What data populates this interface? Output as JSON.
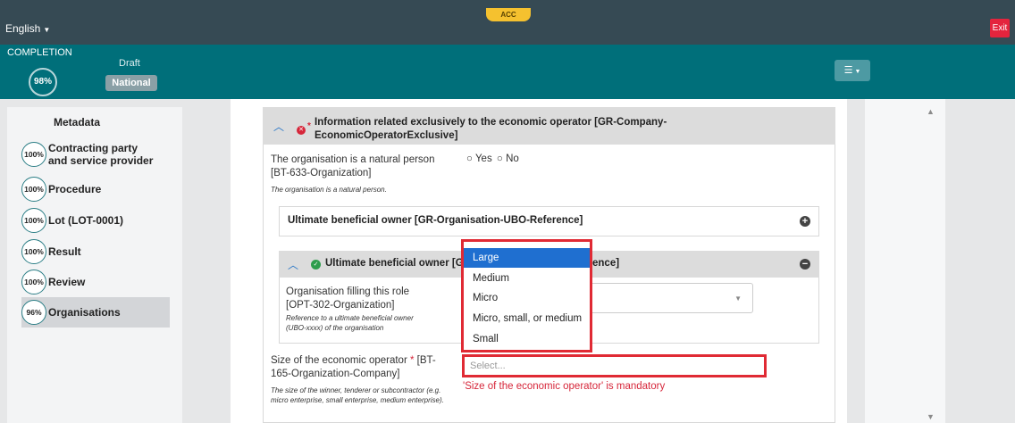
{
  "topbar": {
    "language": "English",
    "env_badge": "ACC",
    "exit_label": "Exit"
  },
  "status": {
    "completion_label": "COMPLETION",
    "completion_percent": "98%",
    "draft_label": "Draft",
    "national_label": "National"
  },
  "sidebar": {
    "metadata_label": "Metadata",
    "items": [
      {
        "percent": "100%",
        "label": "Contracting party and service provider"
      },
      {
        "percent": "100%",
        "label": "Procedure"
      },
      {
        "percent": "100%",
        "label": "Lot (LOT-0001)"
      },
      {
        "percent": "100%",
        "label": "Result"
      },
      {
        "percent": "100%",
        "label": "Review"
      },
      {
        "percent": "96%",
        "label": "Organisations"
      }
    ]
  },
  "section": {
    "title": "Information related exclusively to the economic operator  [GR-Company-EconomicOperatorExclusive]",
    "required_mark": "*",
    "natural_person": {
      "label": "The organisation is a natural person [BT-633-Organization]",
      "help": "The organisation is a natural person.",
      "yes": "Yes",
      "no": "No"
    },
    "ubo_ref_title": "Ultimate beneficial owner  [GR-Organisation-UBO-Reference]",
    "ubo_title_left": "Ultimate beneficial owner  [G",
    "ubo_title_right": "ence]",
    "org_role": {
      "label": "Organisation filling this role [OPT-302-Organization]",
      "help": "Reference to a ultimate beneficial owner (UBO-xxxx) of the organisation"
    },
    "size": {
      "label": "Size of the economic operator",
      "label_suffix": "[BT-165-Organization-Company]",
      "help": "The size of the winner, tenderer or subcontractor (e.g. micro enterprise, small enterprise, medium enterprise).",
      "placeholder": "Select...",
      "error": "'Size of the economic operator' is mandatory"
    }
  },
  "dropdown": {
    "options": [
      "Large",
      "Medium",
      "Micro",
      "Micro, small, or medium",
      "Small"
    ],
    "highlighted": "Large"
  }
}
